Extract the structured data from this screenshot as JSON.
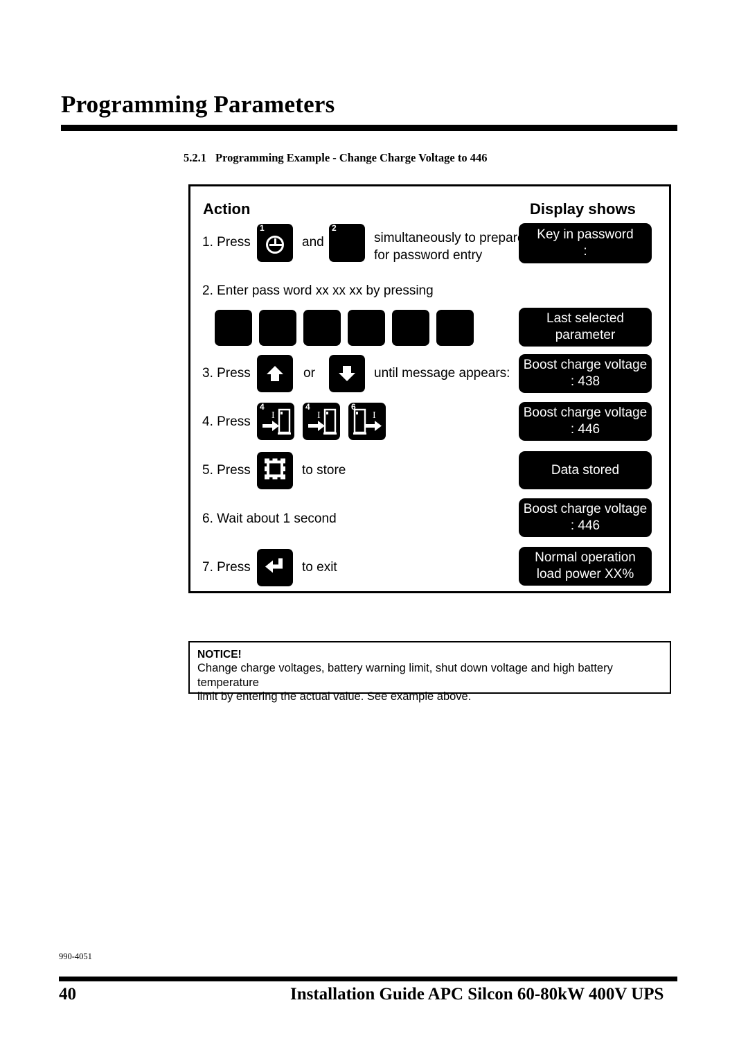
{
  "page": {
    "title": "Programming Parameters",
    "section_number": "5.2.1",
    "section_title": "Programming Example - Change Charge Voltage to 446"
  },
  "table": {
    "col_action": "Action",
    "col_display": "Display shows",
    "steps": [
      {
        "number": "1. Press",
        "mid_text": "and",
        "tail_line1": "simultaneously to prepare",
        "tail_line2": "for password entry",
        "keys": [
          {
            "icon": "clock-icon",
            "sup": "1"
          },
          {
            "icon": "blank-key-icon",
            "sup": "2"
          }
        ],
        "display": {
          "line1": "Key in password",
          "line2": ":"
        }
      },
      {
        "number": "2. Enter pass word xx xx xx by pressing",
        "keys": [
          {
            "icon": "blank-key-icon",
            "sup": ""
          },
          {
            "icon": "blank-key-icon",
            "sup": ""
          },
          {
            "icon": "blank-key-icon",
            "sup": ""
          },
          {
            "icon": "blank-key-icon",
            "sup": ""
          },
          {
            "icon": "blank-key-icon",
            "sup": ""
          },
          {
            "icon": "blank-key-icon",
            "sup": ""
          }
        ],
        "display": {
          "line1": "Last selected",
          "line2": "parameter"
        }
      },
      {
        "number": "3. Press",
        "mid_text": "or",
        "tail_line1": "until message appears:",
        "keys": [
          {
            "icon": "arrow-up-icon",
            "sup": ""
          },
          {
            "icon": "arrow-down-icon",
            "sup": ""
          }
        ],
        "display": {
          "line1": "Boost charge voltage",
          "line2": ": 438"
        }
      },
      {
        "number": "4. Press",
        "keys": [
          {
            "icon": "cabinet-in-icon",
            "sup": "4",
            "label": "I"
          },
          {
            "icon": "cabinet-in-icon",
            "sup": "4",
            "label": "I"
          },
          {
            "icon": "cabinet-out-icon",
            "sup": "6",
            "label": "I"
          }
        ],
        "display": {
          "line1": "Boost charge voltage",
          "line2": ": 446"
        }
      },
      {
        "number": "5. Press",
        "tail_line1": "to store",
        "keys": [
          {
            "icon": "store-icon",
            "sup": ""
          }
        ],
        "display": {
          "line1": "Data stored",
          "line2": ""
        }
      },
      {
        "number": "6. Wait about 1 second",
        "keys": [],
        "display": {
          "line1": "Boost charge voltage",
          "line2": ": 446"
        }
      },
      {
        "number": "7. Press",
        "tail_line1": "to exit",
        "keys": [
          {
            "icon": "enter-icon",
            "sup": ""
          }
        ],
        "display": {
          "line1": "Normal operation",
          "line2": "load power XX%"
        }
      }
    ]
  },
  "notice": {
    "title": "NOTICE!",
    "line1": "Change charge voltages, battery warning limit, shut down voltage and high battery temperature",
    "line2": "limit by entering the actual value. See example above."
  },
  "footer": {
    "doc_code": "990-4051",
    "page_number": "40",
    "title": "Installation Guide APC Silcon 60-80kW 400V UPS"
  }
}
